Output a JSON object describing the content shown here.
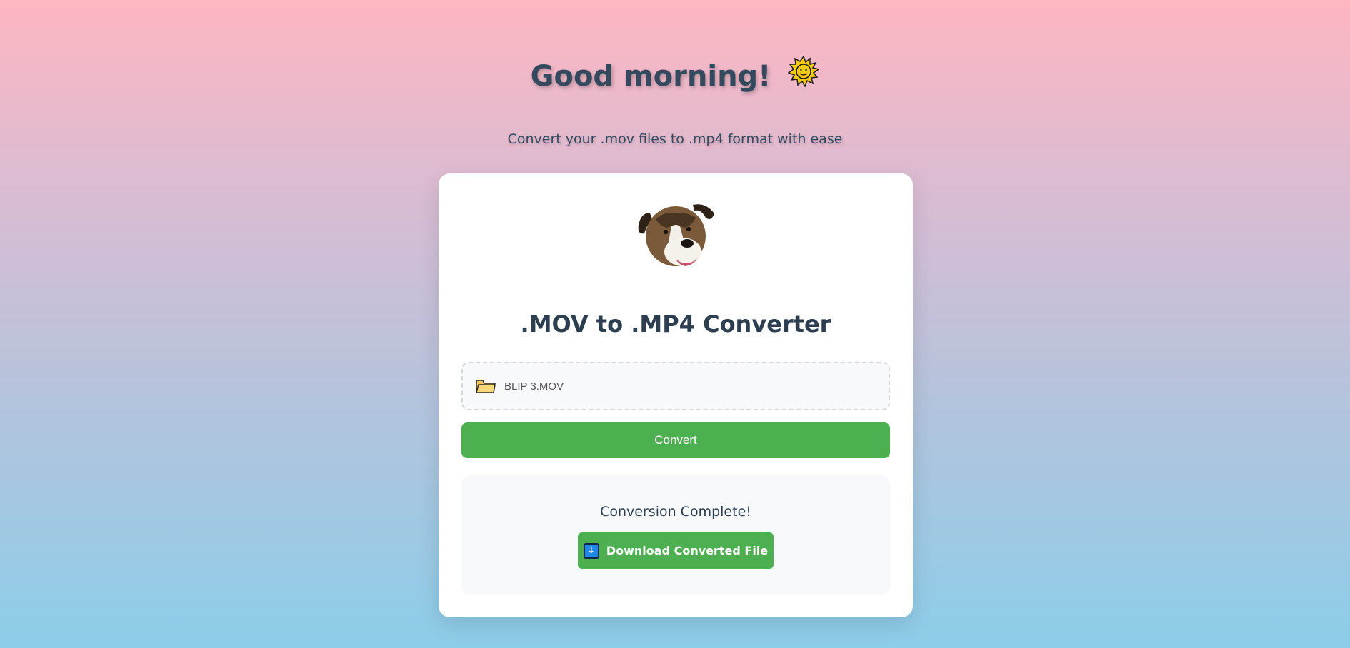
{
  "header": {
    "greeting": "Good morning!",
    "subtitle": "Convert your .mov files to .mp4 format with ease"
  },
  "card": {
    "title": ".MOV to .MP4 Converter",
    "file_picker": {
      "file_name": "BLIP 3.MOV",
      "icon": "folder-icon"
    },
    "convert_label": "Convert",
    "result": {
      "title": "Conversion Complete!",
      "download_label": "Download Converted File",
      "download_icon": "download-icon"
    }
  },
  "colors": {
    "accent_green": "#4caf50",
    "title_text": "#2c3e50",
    "gradient_top": "#feb6c1",
    "gradient_bottom": "#8ccde9"
  }
}
